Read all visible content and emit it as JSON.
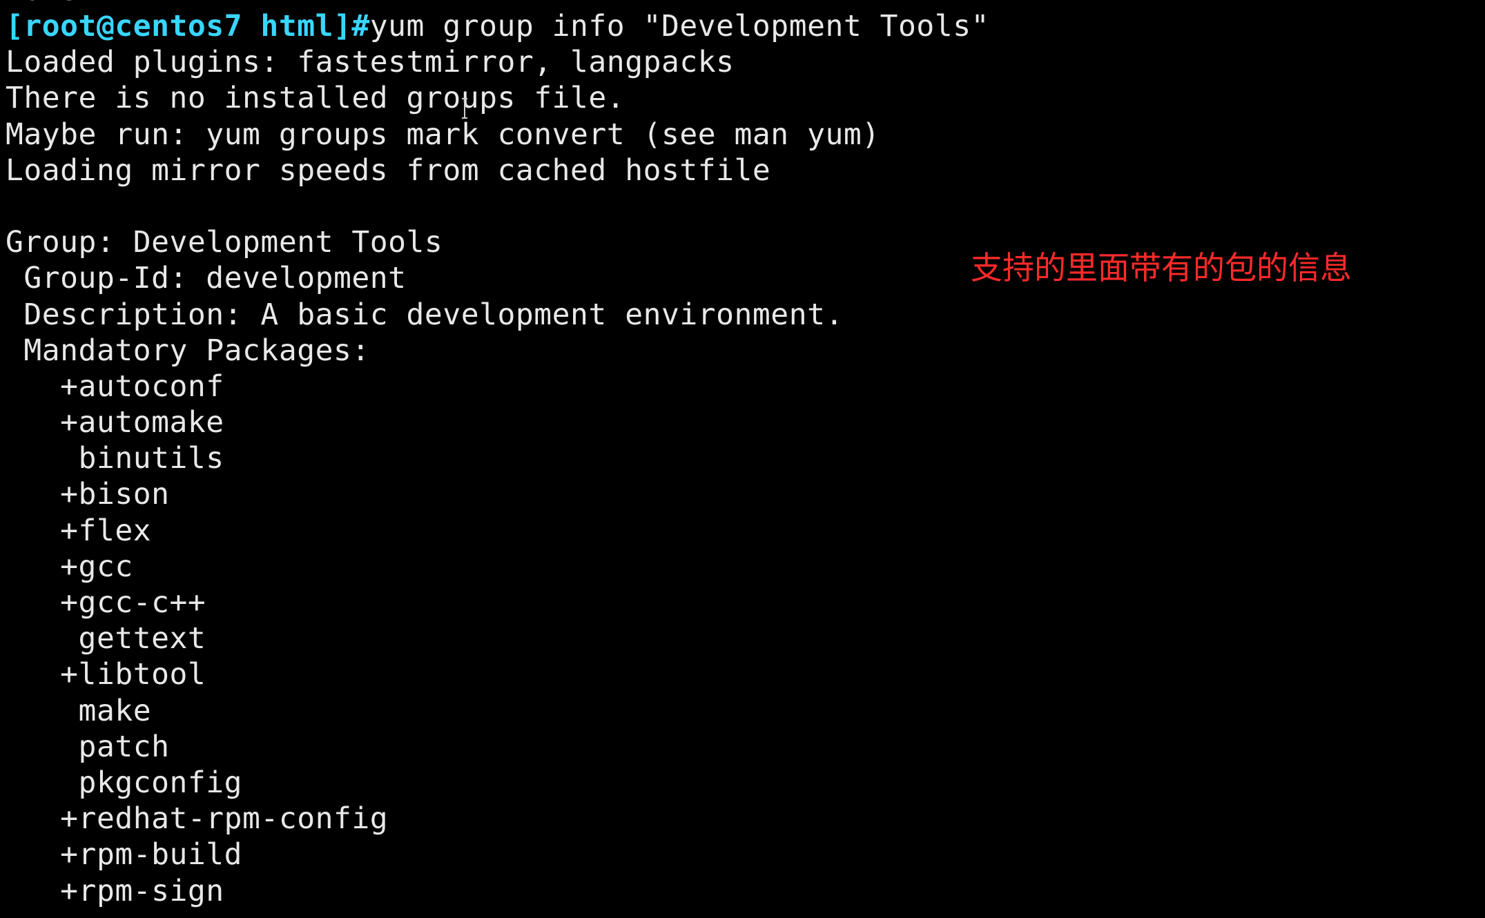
{
  "terminal": {
    "top_clipped_line": "Done",
    "prompt": "[root@centos7 html]#",
    "command": "yum group info \"Development Tools\"",
    "lines": [
      "Loaded plugins: fastestmirror, langpacks",
      "There is no installed groups file.",
      "Maybe run: yum groups mark convert (see man yum)",
      "Loading mirror speeds from cached hostfile",
      "",
      "Group: Development Tools",
      " Group-Id: development",
      " Description: A basic development environment.",
      " Mandatory Packages:",
      "   +autoconf",
      "   +automake",
      "    binutils",
      "   +bison",
      "   +flex",
      "   +gcc",
      "   +gcc-c++",
      "    gettext",
      "   +libtool",
      "    make",
      "    patch",
      "    pkgconfig",
      "   +redhat-rpm-config",
      "   +rpm-build",
      "   +rpm-sign"
    ]
  },
  "annotation": {
    "text": "支持的里面带有的包的信息",
    "color": "#ff2a2a"
  },
  "colors": {
    "background": "#000000",
    "prompt": "#38d6ff",
    "text": "#e8e8e8"
  },
  "icons": {
    "cursor": "text-cursor-icon"
  }
}
